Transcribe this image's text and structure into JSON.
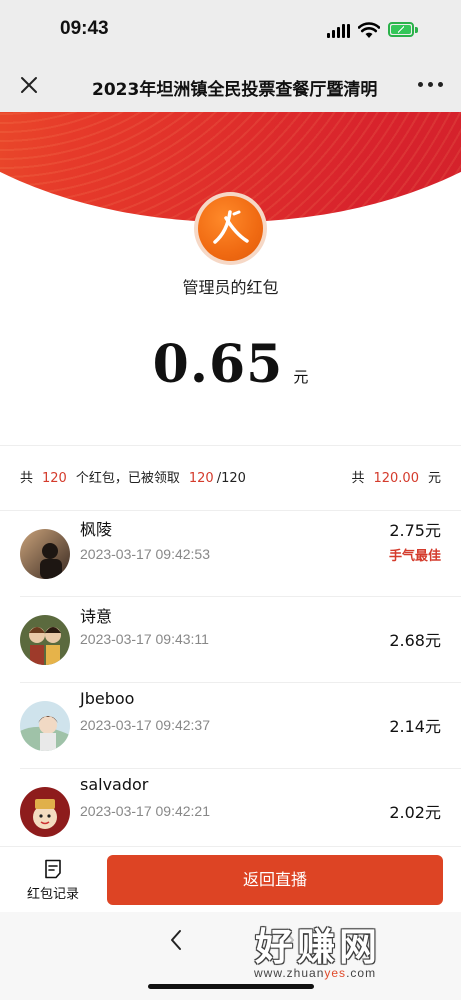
{
  "status_bar": {
    "time": "09:43"
  },
  "nav": {
    "title": "2023年坦洲镇全民投票查餐厅暨清明",
    "close_icon": "close-icon",
    "more_icon": "more-dots-icon"
  },
  "header": {
    "sender": "管理员的红包",
    "amount": "0.65",
    "unit": "元",
    "colors": {
      "primary": "#d8232c",
      "accent": "#f26a2b"
    }
  },
  "summary": {
    "prefix": "共",
    "total_count": "120",
    "middle": "个红包，已被领取",
    "claimed": "120",
    "of_total": "/120",
    "money_prefix": "共",
    "total_money": "120.00",
    "money_unit": "元"
  },
  "list": [
    {
      "name": "枫陵",
      "time": "2023-03-17 09:42:53",
      "amount": "2.75元",
      "lucky": "手气最佳"
    },
    {
      "name": "诗意",
      "time": "2023-03-17 09:43:11",
      "amount": "2.68元"
    },
    {
      "name": "Jbeboo",
      "time": "2023-03-17 09:42:37",
      "amount": "2.14元"
    },
    {
      "name": "salvador",
      "time": "2023-03-17 09:42:21",
      "amount": "2.02元"
    }
  ],
  "bottom": {
    "record_label": "红包记录",
    "back_live_label": "返回直播"
  },
  "watermark": {
    "text": "好赚网",
    "url_prefix": "www.zhuan",
    "url_highlight": "yes",
    "url_suffix": ".com"
  }
}
